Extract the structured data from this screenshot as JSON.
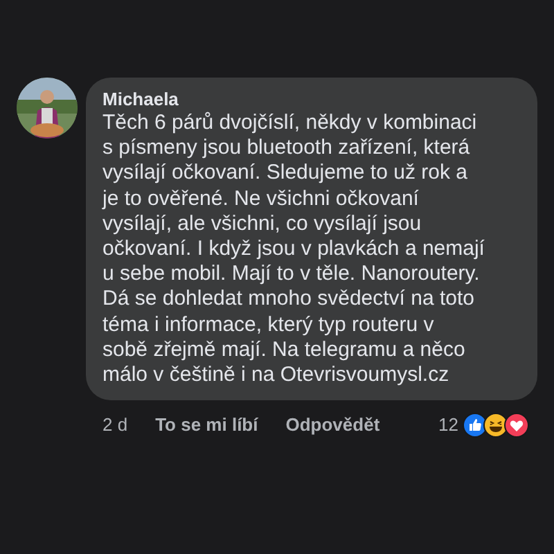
{
  "comment": {
    "author": "Michaela",
    "text": "Těch 6 párů dvojčíslí, někdy v kombinaci\ns písmeny jsou bluetooth zařízení, která\nvysílají očkovaní. Sledujeme to už rok a\nje to ověřené. Ne všichni očkovaní\nvysílají, ale všichni, co vysílají jsou\nočkovaní. I když jsou v plavkách a nemají\nu sebe mobil. Mají to v těle. Nanoroutery.\nDá se dohledat mnoho svědectví na toto\ntéma i informace, který typ routeru v\nsobě zřejmě mají. Na telegramu a něco\nmálo v češtině i na Otevrisvoumysl.cz",
    "time": "2 d",
    "like_label": "To se mi líbí",
    "reply_label": "Odpovědět",
    "reaction_count": "12",
    "reactions": [
      {
        "kind": "like",
        "color": "#1877f2"
      },
      {
        "kind": "haha",
        "color": "#f7b928"
      },
      {
        "kind": "love",
        "color": "#f33e58"
      }
    ]
  }
}
